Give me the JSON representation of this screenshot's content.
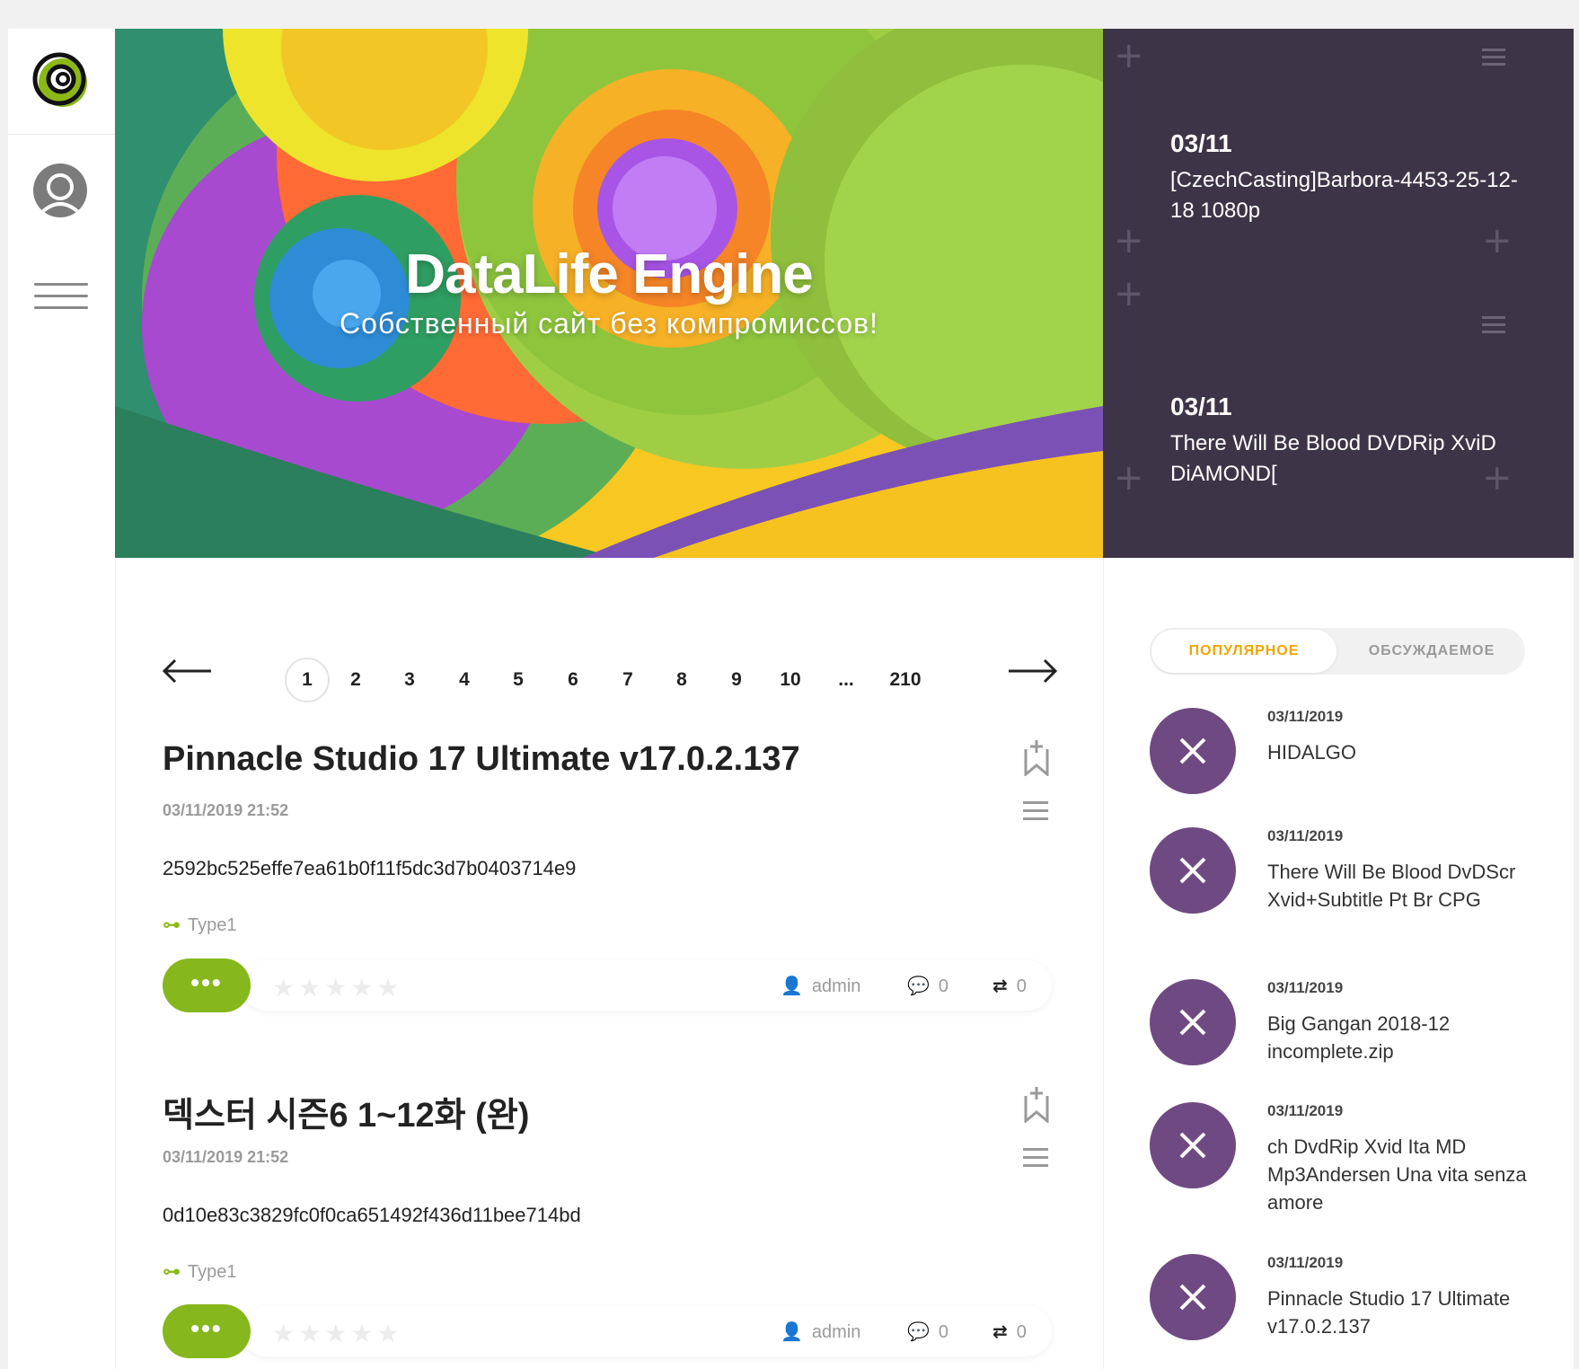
{
  "hero": {
    "title": "DataLife Engine",
    "subtitle": "Собственный сайт без компромиссов!"
  },
  "news_panel": {
    "items": [
      {
        "date": "03/11",
        "title": "[CzechCasting]Barbora-4453-25-12-18 1080p"
      },
      {
        "date": "03/11",
        "title": "There Will Be Blood DVDRip XviD DiAMOND["
      }
    ]
  },
  "pagination": {
    "pages": [
      "1",
      "2",
      "3",
      "4",
      "5",
      "6",
      "7",
      "8",
      "9",
      "10",
      "...",
      "210"
    ],
    "current": "1"
  },
  "posts": [
    {
      "title": "Pinnacle Studio 17 Ultimate v17.0.2.137",
      "date": "03/11/2019 21:52",
      "hash": "2592bc525effe7ea61b0f11f5dc3d7b0403714e9",
      "type": "Type1",
      "more_label": "•••",
      "author": "admin",
      "comments": "0",
      "reposts": "0"
    },
    {
      "title": "덱스터 시즌6 1~12화 (완)",
      "date": "03/11/2019 21:52",
      "hash": "0d10e83c3829fc0f0ca651492f436d11bee714bd",
      "type": "Type1",
      "more_label": "•••",
      "author": "admin",
      "comments": "0",
      "reposts": "0"
    }
  ],
  "tabs": {
    "popular": "ПОПУЛЯРНОЕ",
    "discussed": "ОБСУЖДАЕМОЕ"
  },
  "side_list": [
    {
      "date": "03/11/2019",
      "title": "HIDALGO"
    },
    {
      "date": "03/11/2019",
      "title": "There Will Be Blood DvDScr Xvid+Subtitle Pt Br CPG"
    },
    {
      "date": "03/11/2019",
      "title": "Big Gangan 2018-12 incomplete.zip"
    },
    {
      "date": "03/11/2019",
      "title": "ch DvdRip Xvid Ita MD Mp3Andersen Una vita senza amore"
    },
    {
      "date": "03/11/2019",
      "title": "Pinnacle Studio 17 Ultimate v17.0.2.137"
    }
  ],
  "colors": {
    "accent_green": "#86b71c",
    "accent_orange": "#f0a500",
    "panel_dark": "#3d3547",
    "circle_purple": "#6f4a82"
  }
}
